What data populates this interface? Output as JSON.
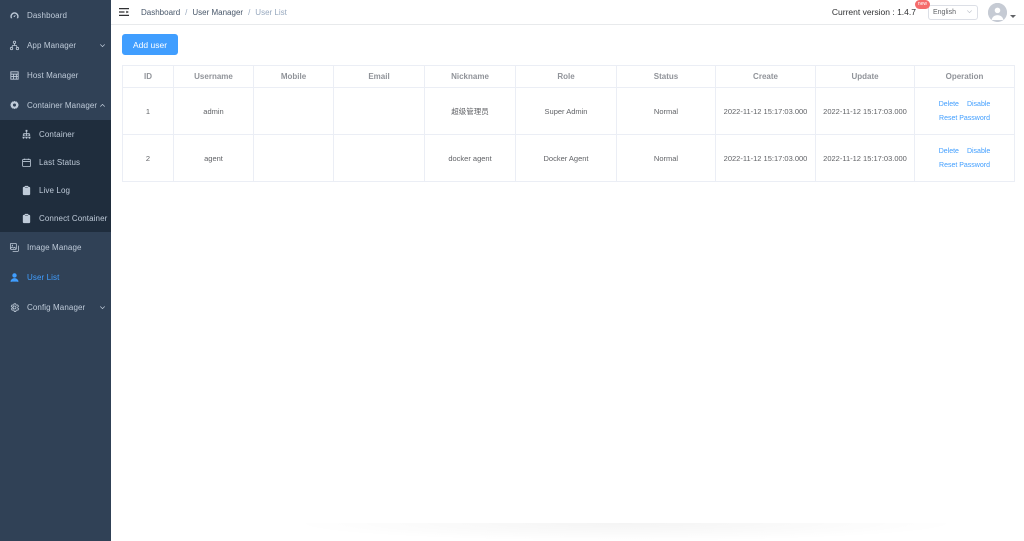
{
  "sidebar": {
    "items": [
      {
        "label": "Dashboard",
        "icon": "dashboard-icon",
        "level": 1,
        "active": false,
        "expandable": false
      },
      {
        "label": "App Manager",
        "icon": "app-manager-icon",
        "level": 1,
        "active": false,
        "expandable": true,
        "arrow": "chevron-down-icon"
      },
      {
        "label": "Host Manager",
        "icon": "host-manager-icon",
        "level": 1,
        "active": false,
        "expandable": false
      },
      {
        "label": "Container Manager",
        "icon": "container-manager-icon",
        "level": 1,
        "active": false,
        "expandable": true,
        "arrow": "chevron-up-icon"
      },
      {
        "label": "Container",
        "icon": "sitemap-icon",
        "level": 2,
        "active": false,
        "expandable": false
      },
      {
        "label": "Last Status",
        "icon": "calendar-icon",
        "level": 2,
        "active": false,
        "expandable": false
      },
      {
        "label": "Live Log",
        "icon": "clipboard-icon",
        "level": 2,
        "active": false,
        "expandable": false
      },
      {
        "label": "Connect Container",
        "icon": "clipboard-icon",
        "level": 2,
        "active": false,
        "expandable": false
      },
      {
        "label": "Image Manage",
        "icon": "image-manage-icon",
        "level": 1,
        "active": false,
        "expandable": false
      },
      {
        "label": "User List",
        "icon": "user-icon",
        "level": 1,
        "active": true,
        "expandable": false
      },
      {
        "label": "Config Manager",
        "icon": "config-gear-icon",
        "level": 1,
        "active": false,
        "expandable": true,
        "arrow": "chevron-down-icon"
      }
    ],
    "background": "#304156",
    "submenu_background": "#1f2d3d",
    "active_color": "#409eff"
  },
  "navbar": {
    "hamburger_icon": "hamburger-icon",
    "breadcrumb": [
      {
        "label": "Dashboard",
        "current": false
      },
      {
        "label": "User Manager",
        "current": false
      },
      {
        "label": "User List",
        "current": true
      }
    ],
    "separator": "/",
    "version_text": "Current version : 1.4.7",
    "version_badge": "new",
    "badge_color": "#f56c6c",
    "language": "English",
    "language_chevron": "chevron-down-icon",
    "avatar_icon": "avatar-icon",
    "avatar_caret": "caret-down-icon"
  },
  "toolbar": {
    "add_user_label": "Add user",
    "add_user_color": "#409eff"
  },
  "table": {
    "columns": [
      "ID",
      "Username",
      "Mobile",
      "Email",
      "Nickname",
      "Role",
      "Status",
      "Create",
      "Update",
      "Operation"
    ],
    "rows": [
      {
        "id": "1",
        "username": "admin",
        "mobile": "",
        "email": "",
        "nickname": "超级管理员",
        "role": "Super Admin",
        "status": "Normal",
        "create": "2022-11-12 15:17:03.000",
        "update": "2022-11-12 15:17:03.000",
        "operations": [
          "Delete",
          "Disable",
          "Reset Password"
        ]
      },
      {
        "id": "2",
        "username": "agent",
        "mobile": "",
        "email": "",
        "nickname": "docker agent",
        "role": "Docker Agent",
        "status": "Normal",
        "create": "2022-11-12 15:17:03.000",
        "update": "2022-11-12 15:17:03.000",
        "operations": [
          "Delete",
          "Disable",
          "Reset Password"
        ]
      }
    ],
    "op_labels": {
      "delete": "Delete",
      "disable": "Disable",
      "reset": "Reset Password"
    },
    "link_color": "#409eff"
  }
}
